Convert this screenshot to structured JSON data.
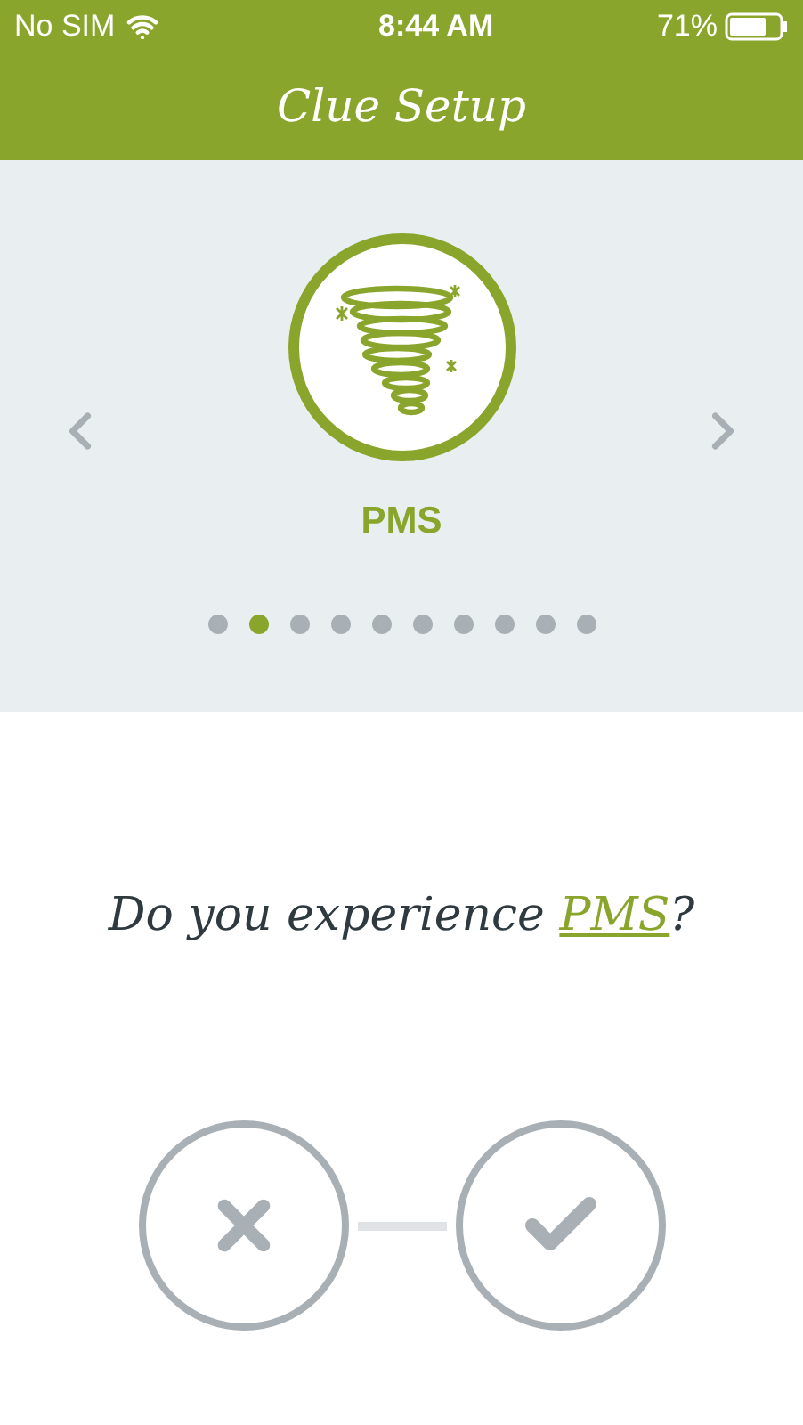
{
  "status_bar": {
    "carrier": "No SIM",
    "time": "8:44 AM",
    "battery": "71%"
  },
  "header": {
    "title": "Clue Setup"
  },
  "carousel": {
    "label": "PMS",
    "dots": [
      {
        "selected": false
      },
      {
        "selected": true
      },
      {
        "selected": false
      },
      {
        "selected": false
      },
      {
        "selected": false
      },
      {
        "selected": false
      },
      {
        "selected": false
      },
      {
        "selected": false
      },
      {
        "selected": false
      },
      {
        "selected": false
      }
    ]
  },
  "question": {
    "before": "Do you experience ",
    "link": "PMS",
    "after": "?"
  }
}
